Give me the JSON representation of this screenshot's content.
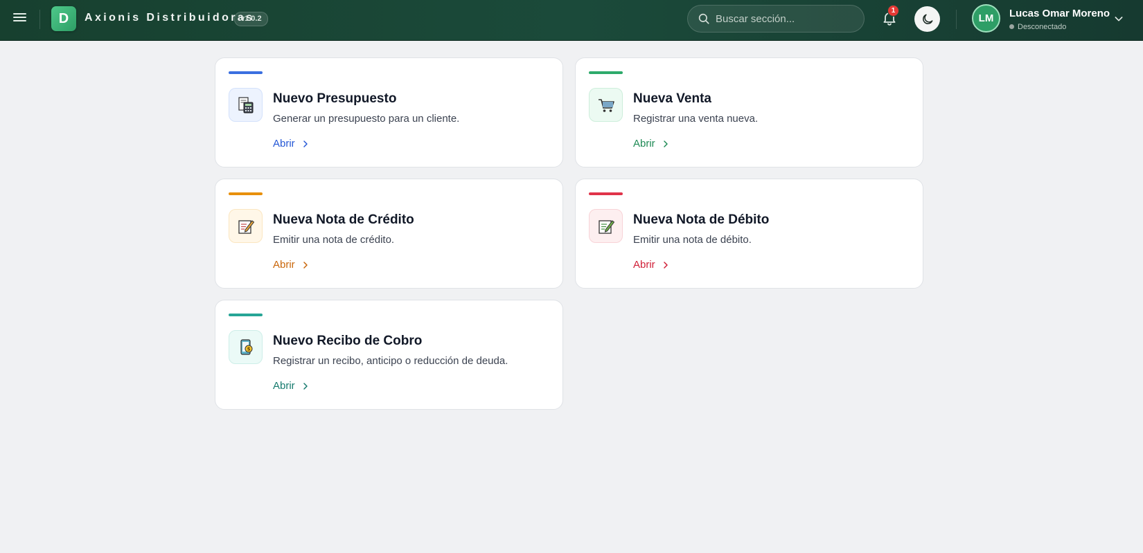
{
  "header": {
    "menu_icon": "hamburger-menu-icon",
    "logo_letter": "D",
    "brand": "Axionis Distribuidoras",
    "version": "v1.0.2",
    "search_placeholder": "Buscar sección...",
    "notifications_count": "1",
    "theme_icon": "moon-icon",
    "user": {
      "initials": "LM",
      "name": "Lucas Omar Moreno",
      "status": "Desconectado"
    }
  },
  "cards": [
    {
      "title": "Nuevo Presupuesto",
      "description": "Generar un presupuesto para un cliente.",
      "link": "Abrir",
      "icon": "calculator-receipt-icon",
      "accent": "#3b6fe0",
      "link_color": "#2457d6",
      "icon_bg": "#edf3fe"
    },
    {
      "title": "Nueva Venta",
      "description": "Registrar una venta nueva.",
      "link": "Abrir",
      "icon": "shopping-cart-icon",
      "accent": "#2eaa6b",
      "link_color": "#1f8a55",
      "icon_bg": "#ecfaf2"
    },
    {
      "title": "Nueva Nota de Crédito",
      "description": "Emitir una nota de crédito.",
      "link": "Abrir",
      "icon": "memo-pencil-icon",
      "accent": "#e8900c",
      "link_color": "#c9660a",
      "icon_bg": "#fff7e8"
    },
    {
      "title": "Nueva Nota de Débito",
      "description": "Emitir una nota de débito.",
      "link": "Abrir",
      "icon": "memo-pencil-icon",
      "accent": "#e0344a",
      "link_color": "#d01f37",
      "icon_bg": "#fdeff0"
    },
    {
      "title": "Nuevo Recibo de Cobro",
      "description": "Registrar un recibo, anticipo o reducción de deuda.",
      "link": "Abrir",
      "icon": "receipt-payment-icon",
      "accent": "#27a596",
      "link_color": "#157a6d",
      "icon_bg": "#ebfaf7"
    }
  ]
}
